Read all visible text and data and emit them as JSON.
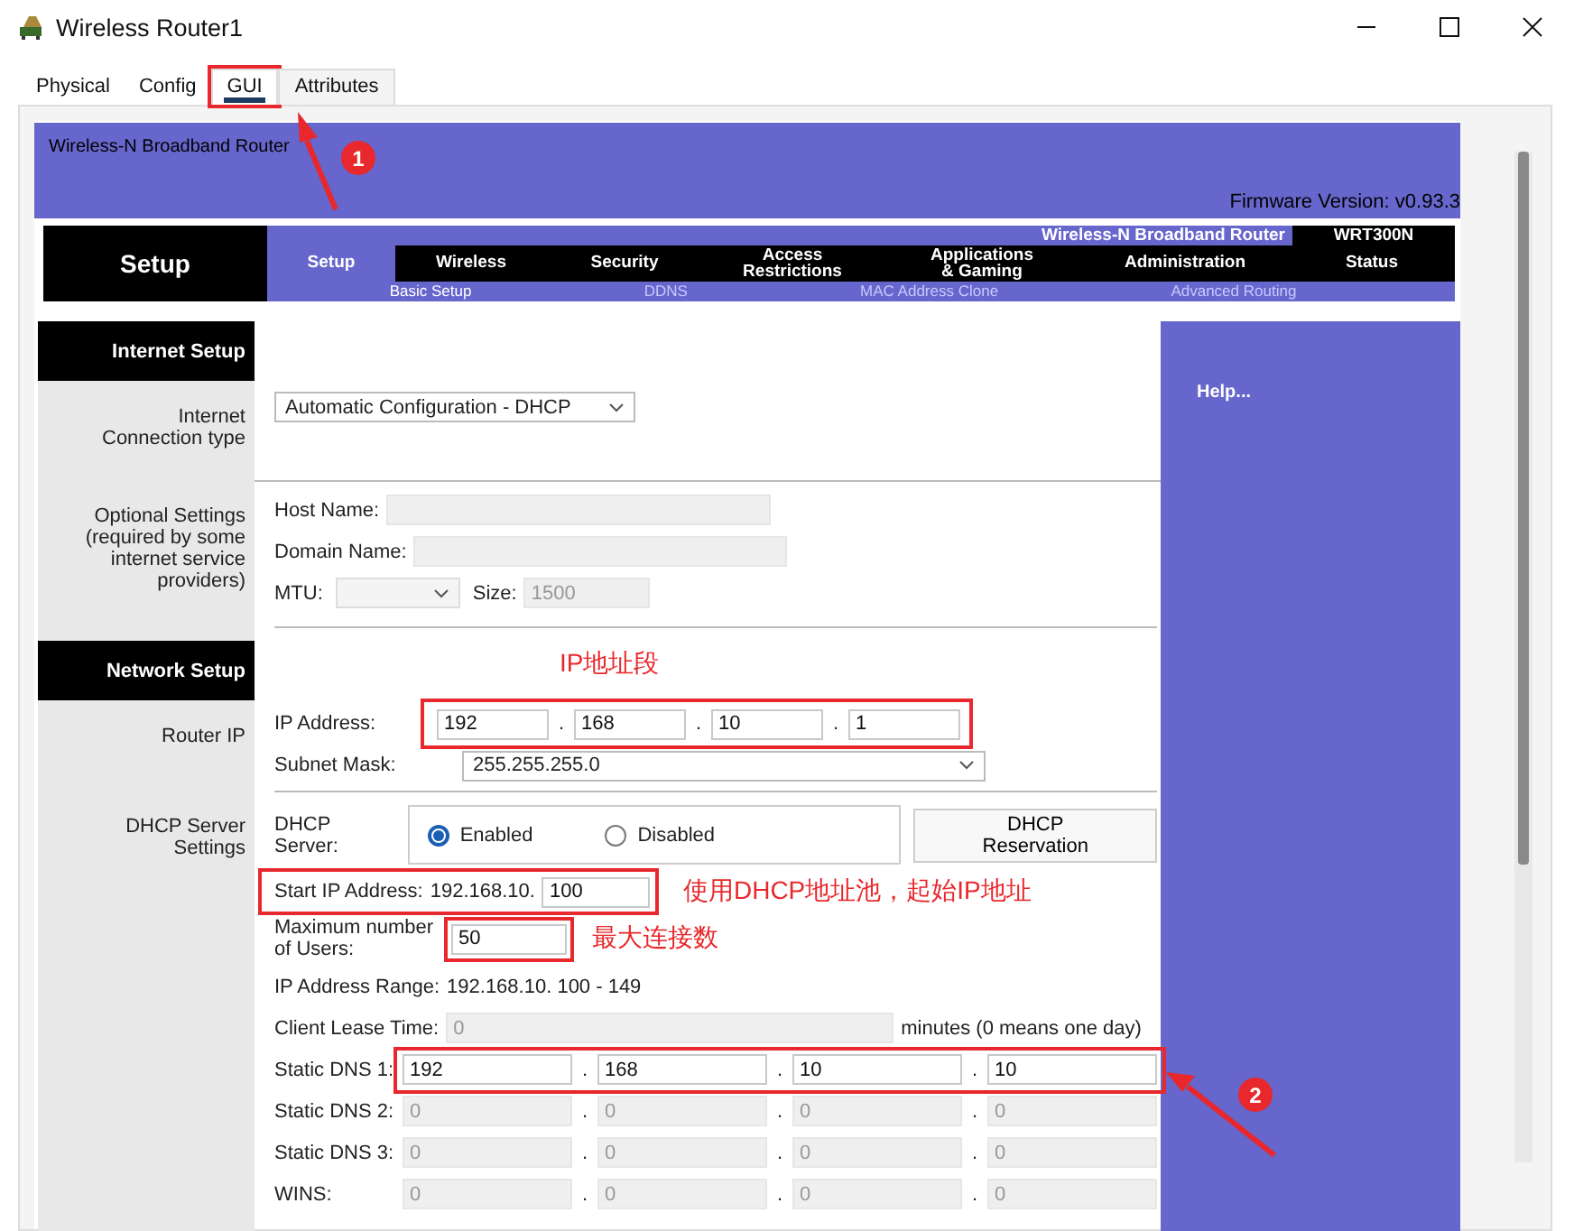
{
  "window": {
    "title": "Wireless Router1"
  },
  "tabs": [
    {
      "label": "Physical",
      "selected": false,
      "highlighted": false
    },
    {
      "label": "Config",
      "selected": false,
      "highlighted": false
    },
    {
      "label": "GUI",
      "selected": true,
      "highlighted": true
    },
    {
      "label": "Attributes",
      "selected": false,
      "highlighted": false
    }
  ],
  "header": {
    "title": "Wireless-N Broadband Router",
    "firmware": "Firmware Version: v0.93.3"
  },
  "nav": {
    "section": "Setup",
    "product": "Wireless-N Broadband Router",
    "model": "WRT300N",
    "tabs": [
      {
        "label": "Setup",
        "selected": true
      },
      {
        "label": "Wireless",
        "selected": false
      },
      {
        "label": "Security",
        "selected": false
      },
      {
        "label": "Access\nRestrictions",
        "selected": false
      },
      {
        "label": "Applications\n& Gaming",
        "selected": false
      },
      {
        "label": "Administration",
        "selected": false
      },
      {
        "label": "Status",
        "selected": false
      }
    ],
    "subtabs": [
      {
        "label": "Basic Setup",
        "selected": true
      },
      {
        "label": "DDNS",
        "selected": false
      },
      {
        "label": "MAC Address Clone",
        "selected": false
      },
      {
        "label": "Advanced Routing",
        "selected": false
      }
    ]
  },
  "internet_setup": {
    "heading": "Internet Setup",
    "connection_label": "Internet\nConnection type",
    "connection_type": "Automatic Configuration - DHCP",
    "optional_label": "Optional Settings\n(required by some\ninternet service\nproviders)",
    "host_name": {
      "label": "Host Name:",
      "disabled": true
    },
    "domain_name": {
      "label": "Domain Name:",
      "disabled": true
    },
    "mtu": {
      "label": "MTU:",
      "disabled": true
    },
    "size": {
      "label": "Size:",
      "value": "1500",
      "disabled": true
    }
  },
  "network_setup": {
    "heading": "Network Setup",
    "note": "IP地址段",
    "router_ip_label": "Router IP",
    "ip_address": {
      "label": "IP Address:",
      "octets": [
        "192",
        "168",
        "10",
        "1"
      ],
      "separators": [
        ".",
        ".",
        "."
      ],
      "highlighted": true
    },
    "subnet_mask": {
      "label": "Subnet Mask:",
      "value": "255.255.255.0"
    },
    "dhcp_label": "DHCP Server\nSettings",
    "dhcp_server": {
      "label": "DHCP\nServer:",
      "options": [
        {
          "label": "Enabled",
          "selected": true
        },
        {
          "label": "Disabled",
          "selected": false
        }
      ]
    },
    "reservation_button": "DHCP\nReservation",
    "start_ip": {
      "label": "Start IP Address:",
      "prefix": "192.168.10.",
      "value": "100",
      "highlighted": true,
      "note": "使用DHCP地址池，起始IP地址"
    },
    "max_users": {
      "label": "Maximum number\nof Users:",
      "value": "50",
      "highlighted": true,
      "note": "最大连接数"
    },
    "ip_range": {
      "label": "IP Address Range:",
      "value": "192.168.10. 100 - 149"
    },
    "lease": {
      "label": "Client Lease Time:",
      "value": "0",
      "disabled": true,
      "suffix": "minutes (0 means one day)"
    },
    "dns": [
      {
        "label": "Static DNS 1:",
        "octets": [
          "192",
          "168",
          "10",
          "10"
        ],
        "separators": [
          ".",
          ".",
          "."
        ],
        "disabled": false,
        "highlighted": true
      },
      {
        "label": "Static DNS 2:",
        "octets": [
          "0",
          "0",
          "0",
          "0"
        ],
        "separators": [
          ".",
          ".",
          "."
        ],
        "disabled": true,
        "highlighted": false
      },
      {
        "label": "Static DNS 3:",
        "octets": [
          "0",
          "0",
          "0",
          "0"
        ],
        "separators": [
          ".",
          ".",
          "."
        ],
        "disabled": true,
        "highlighted": false
      },
      {
        "label": "WINS:",
        "octets": [
          "0",
          "0",
          "0",
          "0"
        ],
        "separators": [
          ".",
          ".",
          "."
        ],
        "disabled": true,
        "highlighted": false
      }
    ]
  },
  "help": "Help...",
  "callouts": [
    {
      "number": "1"
    },
    {
      "number": "2"
    }
  ]
}
